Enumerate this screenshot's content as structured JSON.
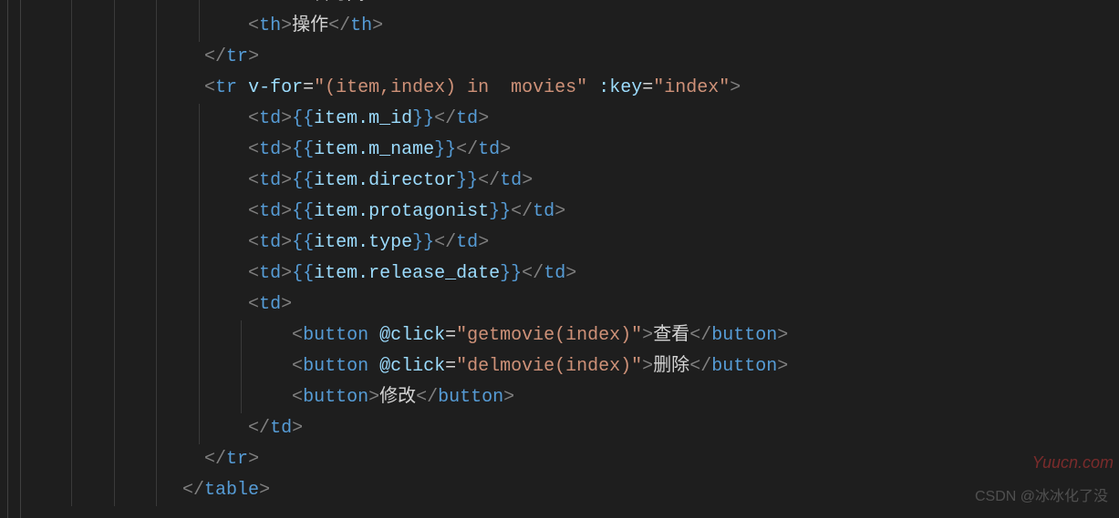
{
  "watermark_csdn": "CSDN @冰冰化了没",
  "watermark_site": "Yuucn.com",
  "lines": [
    {
      "indent": 10,
      "tokens": [
        {
          "t": "brkt",
          "v": "<"
        },
        {
          "t": "tag",
          "v": "th"
        },
        {
          "t": "brkt",
          "v": ">"
        },
        {
          "t": "text",
          "v": "上映时间"
        },
        {
          "t": "brkt",
          "v": "</"
        },
        {
          "t": "tag",
          "v": "th"
        },
        {
          "t": "brkt",
          "v": ">"
        }
      ]
    },
    {
      "indent": 10,
      "tokens": [
        {
          "t": "brkt",
          "v": "<"
        },
        {
          "t": "tag",
          "v": "th"
        },
        {
          "t": "brkt",
          "v": ">"
        },
        {
          "t": "text",
          "v": "操作"
        },
        {
          "t": "brkt",
          "v": "</"
        },
        {
          "t": "tag",
          "v": "th"
        },
        {
          "t": "brkt",
          "v": ">"
        }
      ]
    },
    {
      "indent": 8,
      "tokens": [
        {
          "t": "brkt",
          "v": "</"
        },
        {
          "t": "tag",
          "v": "tr"
        },
        {
          "t": "brkt",
          "v": ">"
        }
      ]
    },
    {
      "indent": 8,
      "tokens": [
        {
          "t": "brkt",
          "v": "<"
        },
        {
          "t": "tag",
          "v": "tr"
        },
        {
          "t": "text",
          "v": " "
        },
        {
          "t": "attr",
          "v": "v-for"
        },
        {
          "t": "text",
          "v": "="
        },
        {
          "t": "str",
          "v": "\"(item,index) in  movies\""
        },
        {
          "t": "text",
          "v": " "
        },
        {
          "t": "attr",
          "v": ":key"
        },
        {
          "t": "text",
          "v": "="
        },
        {
          "t": "str",
          "v": "\"index\""
        },
        {
          "t": "brkt",
          "v": ">"
        }
      ]
    },
    {
      "indent": 10,
      "tokens": [
        {
          "t": "brkt",
          "v": "<"
        },
        {
          "t": "tag",
          "v": "td"
        },
        {
          "t": "brkt",
          "v": ">"
        },
        {
          "t": "mustache",
          "v": "{{"
        },
        {
          "t": "expr",
          "v": "item.m_id"
        },
        {
          "t": "mustache",
          "v": "}}"
        },
        {
          "t": "brkt",
          "v": "</"
        },
        {
          "t": "tag",
          "v": "td"
        },
        {
          "t": "brkt",
          "v": ">"
        }
      ]
    },
    {
      "indent": 10,
      "tokens": [
        {
          "t": "brkt",
          "v": "<"
        },
        {
          "t": "tag",
          "v": "td"
        },
        {
          "t": "brkt",
          "v": ">"
        },
        {
          "t": "mustache",
          "v": "{{"
        },
        {
          "t": "expr",
          "v": "item.m_name"
        },
        {
          "t": "mustache",
          "v": "}}"
        },
        {
          "t": "brkt",
          "v": "</"
        },
        {
          "t": "tag",
          "v": "td"
        },
        {
          "t": "brkt",
          "v": ">"
        }
      ]
    },
    {
      "indent": 10,
      "tokens": [
        {
          "t": "brkt",
          "v": "<"
        },
        {
          "t": "tag",
          "v": "td"
        },
        {
          "t": "brkt",
          "v": ">"
        },
        {
          "t": "mustache",
          "v": "{{"
        },
        {
          "t": "expr",
          "v": "item.director"
        },
        {
          "t": "mustache",
          "v": "}}"
        },
        {
          "t": "brkt",
          "v": "</"
        },
        {
          "t": "tag",
          "v": "td"
        },
        {
          "t": "brkt",
          "v": ">"
        }
      ]
    },
    {
      "indent": 10,
      "tokens": [
        {
          "t": "brkt",
          "v": "<"
        },
        {
          "t": "tag",
          "v": "td"
        },
        {
          "t": "brkt",
          "v": ">"
        },
        {
          "t": "mustache",
          "v": "{{"
        },
        {
          "t": "expr",
          "v": "item.protagonist"
        },
        {
          "t": "mustache",
          "v": "}}"
        },
        {
          "t": "brkt",
          "v": "</"
        },
        {
          "t": "tag",
          "v": "td"
        },
        {
          "t": "brkt",
          "v": ">"
        }
      ]
    },
    {
      "indent": 10,
      "tokens": [
        {
          "t": "brkt",
          "v": "<"
        },
        {
          "t": "tag",
          "v": "td"
        },
        {
          "t": "brkt",
          "v": ">"
        },
        {
          "t": "mustache",
          "v": "{{"
        },
        {
          "t": "expr",
          "v": "item.type"
        },
        {
          "t": "mustache",
          "v": "}}"
        },
        {
          "t": "brkt",
          "v": "</"
        },
        {
          "t": "tag",
          "v": "td"
        },
        {
          "t": "brkt",
          "v": ">"
        }
      ]
    },
    {
      "indent": 10,
      "tokens": [
        {
          "t": "brkt",
          "v": "<"
        },
        {
          "t": "tag",
          "v": "td"
        },
        {
          "t": "brkt",
          "v": ">"
        },
        {
          "t": "mustache",
          "v": "{{"
        },
        {
          "t": "expr",
          "v": "item.release_date"
        },
        {
          "t": "mustache",
          "v": "}}"
        },
        {
          "t": "brkt",
          "v": "</"
        },
        {
          "t": "tag",
          "v": "td"
        },
        {
          "t": "brkt",
          "v": ">"
        }
      ]
    },
    {
      "indent": 10,
      "tokens": [
        {
          "t": "brkt",
          "v": "<"
        },
        {
          "t": "tag",
          "v": "td"
        },
        {
          "t": "brkt",
          "v": ">"
        }
      ]
    },
    {
      "indent": 12,
      "tokens": [
        {
          "t": "brkt",
          "v": "<"
        },
        {
          "t": "tag",
          "v": "button"
        },
        {
          "t": "text",
          "v": " "
        },
        {
          "t": "attr",
          "v": "@click"
        },
        {
          "t": "text",
          "v": "="
        },
        {
          "t": "str",
          "v": "\"getmovie(index)\""
        },
        {
          "t": "brkt",
          "v": ">"
        },
        {
          "t": "text",
          "v": "查看"
        },
        {
          "t": "brkt",
          "v": "</"
        },
        {
          "t": "tag",
          "v": "button"
        },
        {
          "t": "brkt",
          "v": ">"
        }
      ]
    },
    {
      "indent": 12,
      "tokens": [
        {
          "t": "brkt",
          "v": "<"
        },
        {
          "t": "tag",
          "v": "button"
        },
        {
          "t": "text",
          "v": " "
        },
        {
          "t": "attr",
          "v": "@click"
        },
        {
          "t": "text",
          "v": "="
        },
        {
          "t": "str",
          "v": "\"delmovie(index)\""
        },
        {
          "t": "brkt",
          "v": ">"
        },
        {
          "t": "text",
          "v": "删除"
        },
        {
          "t": "brkt",
          "v": "</"
        },
        {
          "t": "tag",
          "v": "button"
        },
        {
          "t": "brkt",
          "v": ">"
        }
      ]
    },
    {
      "indent": 12,
      "tokens": [
        {
          "t": "brkt",
          "v": "<"
        },
        {
          "t": "tag",
          "v": "button"
        },
        {
          "t": "brkt",
          "v": ">"
        },
        {
          "t": "text",
          "v": "修改"
        },
        {
          "t": "brkt",
          "v": "</"
        },
        {
          "t": "tag",
          "v": "button"
        },
        {
          "t": "brkt",
          "v": ">"
        }
      ]
    },
    {
      "indent": 10,
      "tokens": [
        {
          "t": "brkt",
          "v": "</"
        },
        {
          "t": "tag",
          "v": "td"
        },
        {
          "t": "brkt",
          "v": ">"
        }
      ]
    },
    {
      "indent": 8,
      "tokens": [
        {
          "t": "brkt",
          "v": "</"
        },
        {
          "t": "tag",
          "v": "tr"
        },
        {
          "t": "brkt",
          "v": ">"
        }
      ]
    },
    {
      "indent": 7,
      "tokens": [
        {
          "t": "brkt",
          "v": "</"
        },
        {
          "t": "tag",
          "v": "table"
        },
        {
          "t": "brkt",
          "v": ">"
        }
      ]
    }
  ]
}
